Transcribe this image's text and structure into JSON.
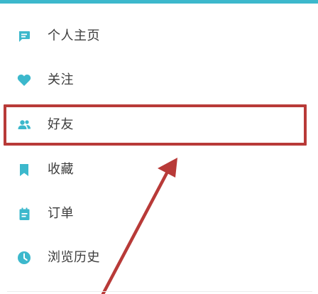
{
  "colors": {
    "accent": "#3cb8cc",
    "highlight": "#b83a38",
    "text": "#3c3c3c"
  },
  "menu": {
    "items": [
      {
        "label": "个人主页",
        "icon": "message-icon"
      },
      {
        "label": "关注",
        "icon": "heart-icon"
      },
      {
        "label": "好友",
        "icon": "friends-icon"
      },
      {
        "label": "收藏",
        "icon": "bookmark-icon"
      },
      {
        "label": "订单",
        "icon": "order-icon"
      },
      {
        "label": "浏览历史",
        "icon": "clock-icon"
      }
    ]
  }
}
